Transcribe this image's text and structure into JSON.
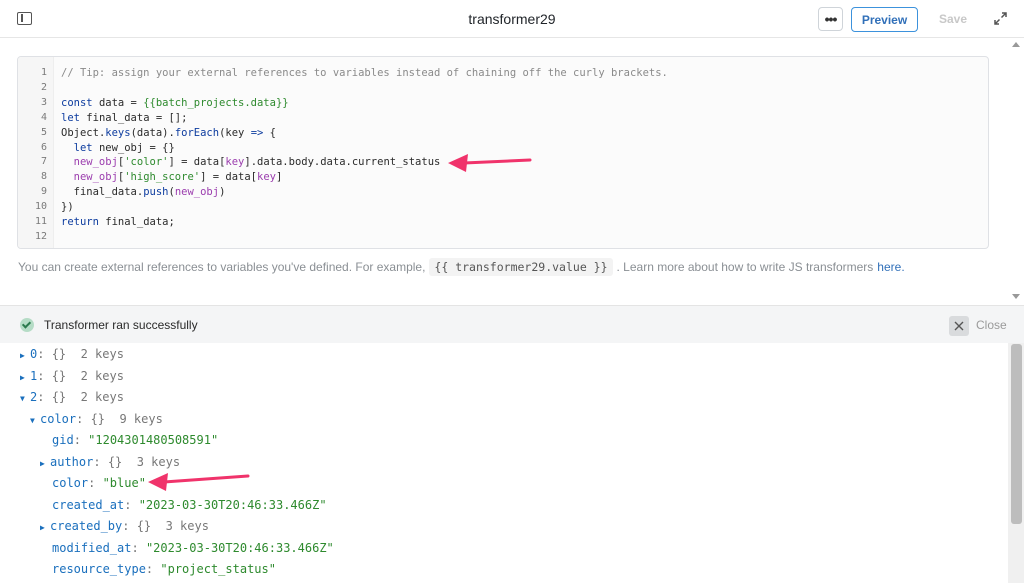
{
  "header": {
    "title": "transformer29",
    "more_label": "•••",
    "preview_label": "Preview",
    "save_label": "Save"
  },
  "editor": {
    "lines": [
      {
        "num": "1",
        "tokens": [
          {
            "t": "// Tip: assign your external references to variables instead of chaining off the curly brackets.",
            "c": "comment"
          }
        ]
      },
      {
        "num": "2",
        "tokens": []
      },
      {
        "num": "3",
        "tokens": [
          {
            "t": "const ",
            "c": "keyword"
          },
          {
            "t": "data = ",
            "c": "plain"
          },
          {
            "t": "{{batch_projects.data}}",
            "c": "template"
          }
        ]
      },
      {
        "num": "4",
        "tokens": [
          {
            "t": "let ",
            "c": "keyword"
          },
          {
            "t": "final_data = [];",
            "c": "plain"
          }
        ]
      },
      {
        "num": "5",
        "tokens": [
          {
            "t": "Object",
            "c": "plain"
          },
          {
            "t": ".",
            "c": "plain"
          },
          {
            "t": "keys",
            "c": "fn"
          },
          {
            "t": "(data).",
            "c": "plain"
          },
          {
            "t": "forEach",
            "c": "fn"
          },
          {
            "t": "(key ",
            "c": "plain"
          },
          {
            "t": "=>",
            "c": "keyword"
          },
          {
            "t": " {",
            "c": "plain"
          }
        ]
      },
      {
        "num": "6",
        "tokens": [
          {
            "t": "  let ",
            "c": "keyword"
          },
          {
            "t": "new_obj = {}",
            "c": "plain"
          }
        ]
      },
      {
        "num": "7",
        "tokens": [
          {
            "t": "  new_obj",
            "c": "var"
          },
          {
            "t": "[",
            "c": "plain"
          },
          {
            "t": "'color'",
            "c": "string"
          },
          {
            "t": "] = data[",
            "c": "plain"
          },
          {
            "t": "key",
            "c": "var"
          },
          {
            "t": "].data.body.data.current_status",
            "c": "plain"
          }
        ]
      },
      {
        "num": "8",
        "tokens": [
          {
            "t": "  new_obj",
            "c": "var"
          },
          {
            "t": "[",
            "c": "plain"
          },
          {
            "t": "'high_score'",
            "c": "string"
          },
          {
            "t": "] = data[",
            "c": "plain"
          },
          {
            "t": "key",
            "c": "var"
          },
          {
            "t": "]",
            "c": "plain"
          }
        ]
      },
      {
        "num": "9",
        "tokens": [
          {
            "t": "  final_data.",
            "c": "plain"
          },
          {
            "t": "push",
            "c": "fn"
          },
          {
            "t": "(",
            "c": "plain"
          },
          {
            "t": "new_obj",
            "c": "var"
          },
          {
            "t": ")",
            "c": "plain"
          }
        ]
      },
      {
        "num": "10",
        "tokens": [
          {
            "t": "})",
            "c": "plain"
          }
        ]
      },
      {
        "num": "11",
        "tokens": [
          {
            "t": "return ",
            "c": "keyword"
          },
          {
            "t": "final_data;",
            "c": "plain"
          }
        ]
      },
      {
        "num": "12",
        "tokens": []
      }
    ]
  },
  "description": {
    "before": "You can create external references to variables you've defined. For example,",
    "code": "{{ transformer29.value }}",
    "after": ". Learn more about how to write JS transformers",
    "link": "here."
  },
  "status": {
    "message": "Transformer ran successfully",
    "close_label": "Close"
  },
  "tree": {
    "rows": [
      {
        "indent": 0,
        "arrow": "right",
        "key": "0",
        "meta": "{}  2 keys"
      },
      {
        "indent": 0,
        "arrow": "right",
        "key": "1",
        "meta": "{}  2 keys"
      },
      {
        "indent": 0,
        "arrow": "down",
        "key": "2",
        "meta": "{}  2 keys"
      },
      {
        "indent": 1,
        "arrow": "down",
        "key": "color",
        "meta": "{}  9 keys"
      },
      {
        "indent": 2,
        "arrow": "",
        "key": "gid",
        "value": "\"1204301480508591\""
      },
      {
        "indent": 2,
        "arrow": "right",
        "key": "author",
        "meta": "{}  3 keys"
      },
      {
        "indent": 2,
        "arrow": "",
        "key": "color",
        "value": "\"blue\""
      },
      {
        "indent": 2,
        "arrow": "",
        "key": "created_at",
        "value": "\"2023-03-30T20:46:33.466Z\""
      },
      {
        "indent": 2,
        "arrow": "right",
        "key": "created_by",
        "meta": "{}  3 keys"
      },
      {
        "indent": 2,
        "arrow": "",
        "key": "modified_at",
        "value": "\"2023-03-30T20:46:33.466Z\""
      },
      {
        "indent": 2,
        "arrow": "",
        "key": "resource_type",
        "value": "\"project_status\""
      }
    ]
  },
  "colors": {
    "accent": "#3170b9",
    "annotation_arrow": "#f0336b",
    "success": "#2c7a4e"
  }
}
